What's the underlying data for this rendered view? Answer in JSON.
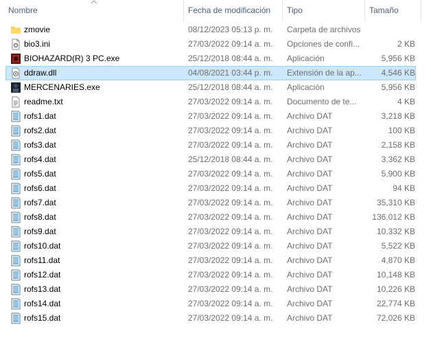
{
  "columns": {
    "name": "Nombre",
    "date": "Fecha de modificación",
    "type": "Tipo",
    "size": "Tamaño"
  },
  "files": [
    {
      "name": "zmovie",
      "date": "08/12/2023 05:13 p. m.",
      "type": "Carpeta de archivos",
      "size": "",
      "icon": "folder-icon"
    },
    {
      "name": "bio3.ini",
      "date": "27/03/2022 09:14 a. m.",
      "type": "Opciones de confi...",
      "size": "2 KB",
      "icon": "settings-file-icon"
    },
    {
      "name": "BIOHAZARD(R) 3 PC.exe",
      "date": "25/12/2018 08:44 a. m.",
      "type": "Aplicación",
      "size": "5,956 KB",
      "icon": "biohazard-app-icon"
    },
    {
      "name": "ddraw.dll",
      "date": "04/08/2021 03:44 p. m.",
      "type": "Extensión de la ap...",
      "size": "4,546 KB",
      "icon": "dll-file-icon"
    },
    {
      "name": "MERCENARIES.exe",
      "date": "25/12/2018 08:44 a. m.",
      "type": "Aplicación",
      "size": "5,956 KB",
      "icon": "mercenaries-app-icon"
    },
    {
      "name": "readme.txt",
      "date": "27/03/2022 09:14 a. m.",
      "type": "Documento de te...",
      "size": "4 KB",
      "icon": "text-file-icon"
    },
    {
      "name": "rofs1.dat",
      "date": "27/03/2022 09:14 a. m.",
      "type": "Archivo DAT",
      "size": "3,218 KB",
      "icon": "dat-file-icon"
    },
    {
      "name": "rofs2.dat",
      "date": "27/03/2022 09:14 a. m.",
      "type": "Archivo DAT",
      "size": "100 KB",
      "icon": "dat-file-icon"
    },
    {
      "name": "rofs3.dat",
      "date": "27/03/2022 09:14 a. m.",
      "type": "Archivo DAT",
      "size": "2,158 KB",
      "icon": "dat-file-icon"
    },
    {
      "name": "rofs4.dat",
      "date": "25/12/2018 08:44 a. m.",
      "type": "Archivo DAT",
      "size": "3,362 KB",
      "icon": "dat-file-icon"
    },
    {
      "name": "rofs5.dat",
      "date": "27/03/2022 09:14 a. m.",
      "type": "Archivo DAT",
      "size": "5,900 KB",
      "icon": "dat-file-icon"
    },
    {
      "name": "rofs6.dat",
      "date": "27/03/2022 09:14 a. m.",
      "type": "Archivo DAT",
      "size": "94 KB",
      "icon": "dat-file-icon"
    },
    {
      "name": "rofs7.dat",
      "date": "27/03/2022 09:14 a. m.",
      "type": "Archivo DAT",
      "size": "35,310 KB",
      "icon": "dat-file-icon"
    },
    {
      "name": "rofs8.dat",
      "date": "27/03/2022 09:14 a. m.",
      "type": "Archivo DAT",
      "size": "136,012 KB",
      "icon": "dat-file-icon"
    },
    {
      "name": "rofs9.dat",
      "date": "27/03/2022 09:14 a. m.",
      "type": "Archivo DAT",
      "size": "10,332 KB",
      "icon": "dat-file-icon"
    },
    {
      "name": "rofs10.dat",
      "date": "27/03/2022 09:14 a. m.",
      "type": "Archivo DAT",
      "size": "5,522 KB",
      "icon": "dat-file-icon"
    },
    {
      "name": "rofs11.dat",
      "date": "27/03/2022 09:14 a. m.",
      "type": "Archivo DAT",
      "size": "4,870 KB",
      "icon": "dat-file-icon"
    },
    {
      "name": "rofs12.dat",
      "date": "27/03/2022 09:14 a. m.",
      "type": "Archivo DAT",
      "size": "10,148 KB",
      "icon": "dat-file-icon"
    },
    {
      "name": "rofs13.dat",
      "date": "27/03/2022 09:14 a. m.",
      "type": "Archivo DAT",
      "size": "10,226 KB",
      "icon": "dat-file-icon"
    },
    {
      "name": "rofs14.dat",
      "date": "27/03/2022 09:14 a. m.",
      "type": "Archivo DAT",
      "size": "22,774 KB",
      "icon": "dat-file-icon"
    },
    {
      "name": "rofs15.dat",
      "date": "27/03/2022 09:14 a. m.",
      "type": "Archivo DAT",
      "size": "72,026 KB",
      "icon": "dat-file-icon"
    }
  ],
  "selected_index": 3,
  "sort_column": "name",
  "colors": {
    "header_text": "#4c607a",
    "selection_bg": "#cce8ff",
    "selection_border": "#99d1ff",
    "secondary_text": "#6d6d6d"
  }
}
